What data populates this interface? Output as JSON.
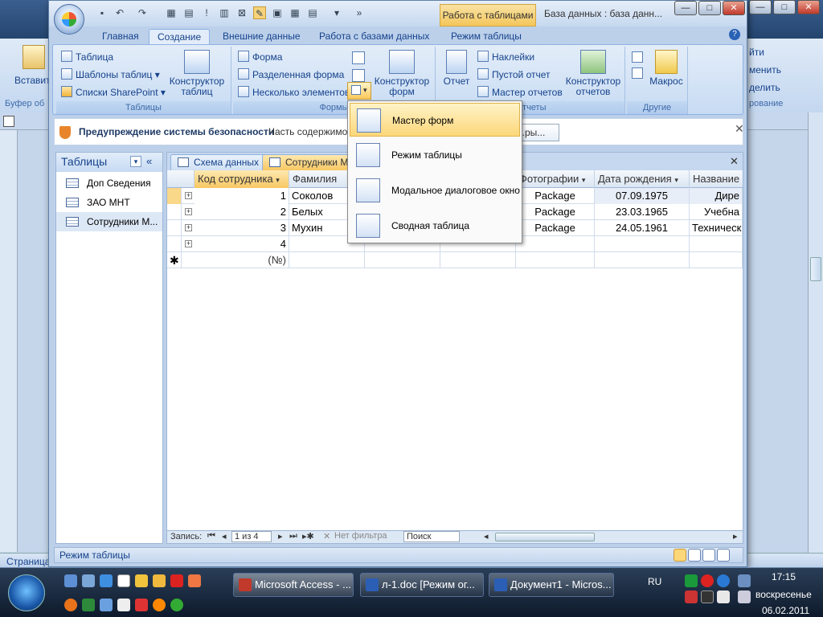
{
  "background_word": {
    "ribbon_left_labels": [
      "Вставить",
      "Буфер об"
    ],
    "ribbon_right_labels": [
      "йти",
      "менить",
      "делить",
      "рование"
    ],
    "statusbar_left": "Страница"
  },
  "window": {
    "context_tab": "Работа с таблицами",
    "title": "База данных : база данн...",
    "controls": {
      "minimize": "—",
      "maximize": "□",
      "close": "✕"
    },
    "help_button": "?"
  },
  "ribbon_tabs": [
    "Главная",
    "Создание",
    "Внешние данные",
    "Работа с базами данных",
    "Режим таблицы"
  ],
  "ribbon": {
    "tables": {
      "items": [
        "Таблица",
        "Шаблоны таблиц",
        "Списки SharePoint"
      ],
      "designer": "Конструктор таблиц",
      "label": "Таблицы"
    },
    "forms": {
      "items": [
        "Форма",
        "Разделенная форма",
        "Несколько элементов"
      ],
      "designer": "Конструктор форм",
      "label": "Формы"
    },
    "reports": {
      "report": "Отчет",
      "items": [
        "Наклейки",
        "Пустой отчет",
        "Мастер отчетов"
      ],
      "designer": "Конструктор отчетов",
      "label": "Отчеты"
    },
    "other": {
      "macro": "Макрос",
      "label": "Другие"
    }
  },
  "security": {
    "title": "Предупреждение системы безопасности",
    "text": "Часть содержимого",
    "button": "...ры...",
    "close": "✕"
  },
  "nav": {
    "header": "Таблицы",
    "items": [
      "Доп Сведения",
      "ЗАО МНТ",
      "Сотрудники М..."
    ]
  },
  "doc_tabs": [
    "Схема данных",
    "Сотрудники М"
  ],
  "doc_close": "✕",
  "grid": {
    "columns": [
      "Код сотрудника",
      "Фамилия",
      "",
      "",
      "Фотографии",
      "Дата рождения",
      "Название"
    ],
    "rows": [
      {
        "id": "1",
        "surname": "Соколов",
        "photo": "Package",
        "birth": "07.09.1975",
        "title": "Дире"
      },
      {
        "id": "2",
        "surname": "Белых",
        "photo": "Package",
        "birth": "23.03.1965",
        "title": "Учебна"
      },
      {
        "id": "3",
        "surname": "Мухин",
        "photo": "Package",
        "birth": "24.05.1961",
        "title": "Техническ"
      },
      {
        "id": "4",
        "surname": "",
        "photo": "",
        "birth": "",
        "title": ""
      }
    ],
    "new_row": "(№)"
  },
  "record_bar": {
    "label": "Запись:",
    "position": "1 из 4",
    "filter": "Нет фильтра",
    "search": "Поиск"
  },
  "status": "Режим таблицы",
  "dropdown_menu": [
    "Мастер форм",
    "Режим таблицы",
    "Модальное диалоговое окно",
    "Сводная таблица"
  ],
  "taskbar": {
    "buttons": [
      "Microsoft Access - ...",
      "л-1.doc [Режим ог...",
      "Документ1 - Micros..."
    ],
    "lang": "RU",
    "time": "17:15",
    "day": "воскресенье",
    "date": "06.02.2011"
  }
}
